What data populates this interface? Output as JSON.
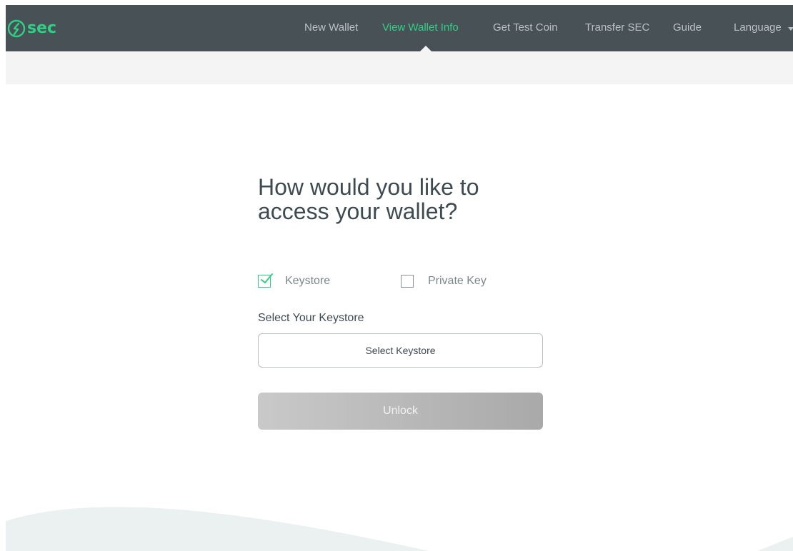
{
  "header": {
    "logo_text": "sec",
    "nav": [
      {
        "label": "New Wallet",
        "active": false
      },
      {
        "label": "View Wallet Info",
        "active": true
      },
      {
        "label": "Get Test Coin",
        "active": false
      },
      {
        "label": "Transfer SEC",
        "active": false
      },
      {
        "label": "Guide",
        "active": false
      },
      {
        "label": "Language",
        "active": false
      }
    ]
  },
  "main": {
    "title_line1": "How would you like to",
    "title_line2": "access your wallet?",
    "options": [
      {
        "label": "Keystore",
        "checked": true
      },
      {
        "label": "Private Key",
        "checked": false
      }
    ],
    "field_label": "Select Your Keystore",
    "select_button": "Select Keystore",
    "unlock_button": "Unlock"
  },
  "colors": {
    "accent": "#2fcf86",
    "navbar": "#485256",
    "subbar": "#f4f4f4",
    "text": "#3d4a4f",
    "wave": "#eaf1f0"
  },
  "icons": {
    "logo": "sec-logo-icon",
    "checked": "checkbox-checked-icon",
    "unchecked": "checkbox-empty-icon",
    "language_caret": "caret-down-icon"
  }
}
